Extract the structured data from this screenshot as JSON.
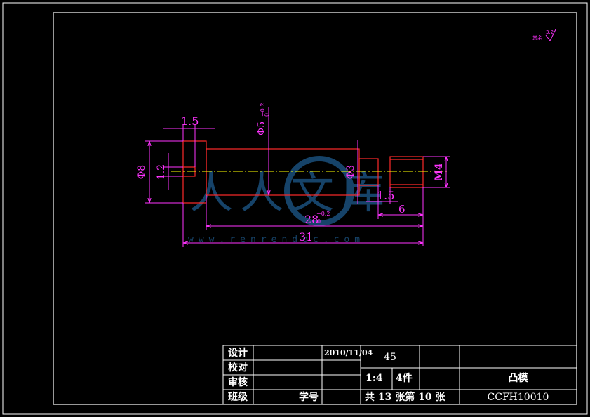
{
  "drawing": {
    "dimensions": {
      "shoulder_length": "1.5",
      "body_diameter": "Φ5",
      "body_tol_upper": "+0.2",
      "body_tol_lower": "0",
      "head_diameter": "Φ8",
      "hole_diameter": "1.2",
      "neck_diameter": "Φ3",
      "thread": "M4",
      "groove_length": "1.5",
      "thread_length": "6",
      "body_length": "28",
      "body_len_tol_upper": "+0.2",
      "body_len_tol_lower": "0",
      "total_length": "31"
    },
    "surface_finish": {
      "value": "3.2",
      "label": "其余"
    },
    "watermark": {
      "logo_text": "人人文库",
      "url_text": "www.renrendoc.com"
    }
  },
  "title_block": {
    "design_label": "设计",
    "design_date": "2010/11/04",
    "check_label": "校对",
    "review_label": "审核",
    "class_label": "班级",
    "student_no_label": "学号",
    "material": "45",
    "scale": "1:4",
    "quantity": "4件",
    "sheet_info": "共 13 张第 10 张",
    "part_name": "凸模",
    "drawing_number": "CCFH10010"
  },
  "colors": {
    "border": "#ffffff",
    "part_outline": "#ff2a2a",
    "dimension": "#ff33ff",
    "centerline": "#ffff00",
    "watermark": "#1e5a8c"
  }
}
